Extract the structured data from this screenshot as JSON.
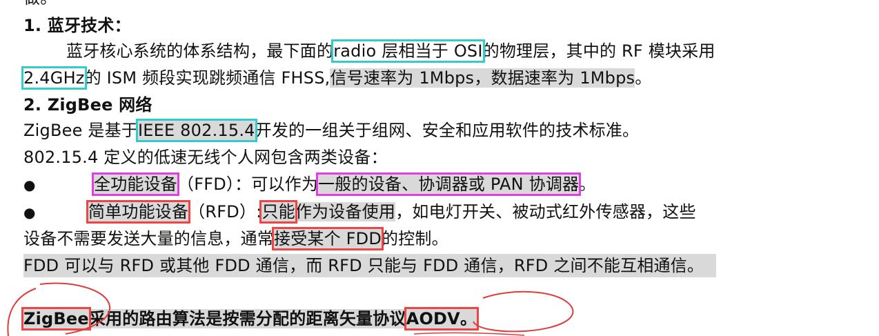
{
  "top_fragment": "做。",
  "section1": {
    "heading": "1.  蓝牙技术：",
    "p1": {
      "a": "蓝牙核心系统的体系结构，最下面的",
      "b": "radio 层相当于 OSI",
      "c": "的物理层，其中的 RF 模块采用"
    },
    "p2": {
      "a": "2.4GHz",
      "b": "的 ISM 频段实现跳频通信 FHSS,",
      "c": "信号速率为 1Mbps，数据速率为 1Mbps",
      "d": "。"
    }
  },
  "section2": {
    "heading": "2.  ZigBee 网络",
    "p1": {
      "a": "ZigBee 是基于",
      "b": "IEEE 802.15.4",
      "c": "开发的一组关于组网、安全和应用软件的技术标准。"
    },
    "p2": "802.15.4  定义的低速无线个人网包含两类设备：",
    "bullet_symbol": "●",
    "b1": {
      "a": "全功能设备",
      "b": "（FFD）：可以作为",
      "c": "一般的设备、协调器或 PAN 协调器",
      "d": "。"
    },
    "b2": {
      "a": "简单功能设备",
      "b": "（RFD）:",
      "c": "只能",
      "d": "作为设备使用",
      "e": "，如电灯开关、被动式红外传感器，这些"
    },
    "b2_cont": {
      "a": "设备不需要发送大量的信息，通常",
      "b": "接受某个 FDD",
      "c": "的控制。"
    },
    "note": "FDD 可以与 RFD 或其他 FDD 通信，而 RFD 只能与 FDD 通信，RFD 之间不能互相通信。",
    "routing": {
      "a": "ZigBee",
      "b": "采用的路由算法是按需分配的距离矢量协议",
      "c": "AODV。"
    }
  },
  "colors": {
    "cyan_box": "#33cccc",
    "magenta_box": "#e040e0",
    "red_box": "#ee4444",
    "highlight": "#d9d9d9",
    "ink": "#e03b3b"
  }
}
